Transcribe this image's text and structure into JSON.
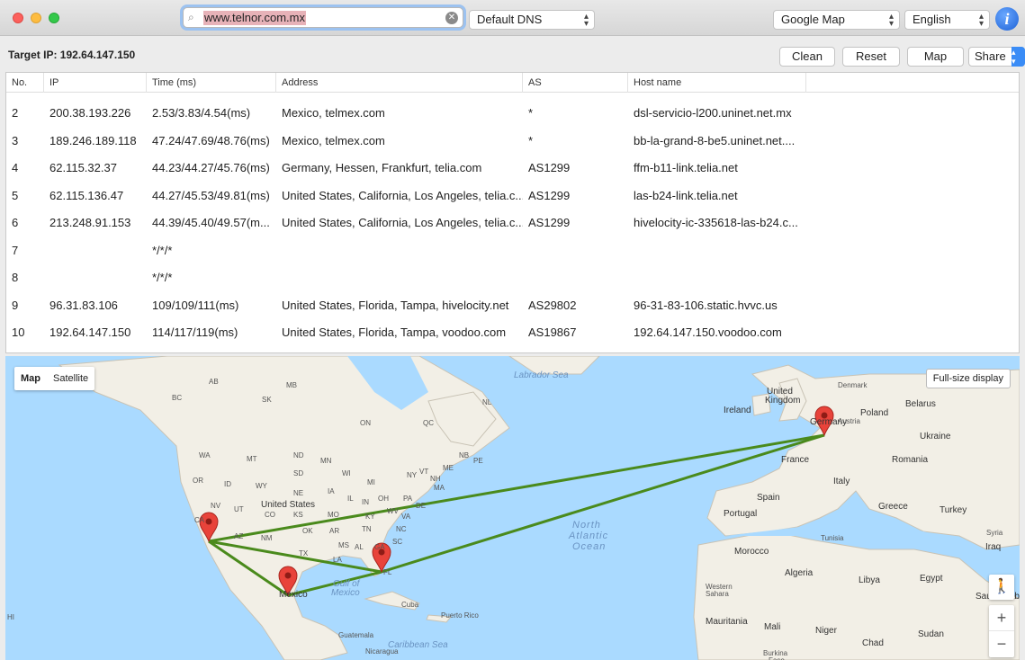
{
  "search": {
    "value": "www.telnor.com.mx"
  },
  "dns_select": {
    "value": "Default DNS"
  },
  "map_select": {
    "value": "Google Map"
  },
  "language_select": {
    "value": "English"
  },
  "target": {
    "label": "Target IP:",
    "ip": "192.64.147.150"
  },
  "buttons": {
    "clean": "Clean",
    "reset": "Reset",
    "map": "Map",
    "share": "Share"
  },
  "table": {
    "headers": [
      "No.",
      "IP",
      "Time (ms)",
      "Address",
      "AS",
      "Host name"
    ],
    "rows": [
      {
        "no": "2",
        "ip": "200.38.193.226",
        "time": "2.53/3.83/4.54(ms)",
        "address": "Mexico, telmex.com",
        "as": "*",
        "host": "dsl-servicio-l200.uninet.net.mx"
      },
      {
        "no": "3",
        "ip": "189.246.189.118",
        "time": "47.24/47.69/48.76(ms)",
        "address": "Mexico, telmex.com",
        "as": "*",
        "host": "bb-la-grand-8-be5.uninet.net...."
      },
      {
        "no": "4",
        "ip": "62.115.32.37",
        "time": "44.23/44.27/45.76(ms)",
        "address": "Germany, Hessen, Frankfurt, telia.com",
        "as": "AS1299",
        "host": "ffm-b11-link.telia.net"
      },
      {
        "no": "5",
        "ip": "62.115.136.47",
        "time": "44.27/45.53/49.81(ms)",
        "address": "United States, California, Los Angeles, telia.c...",
        "as": "AS1299",
        "host": "las-b24-link.telia.net"
      },
      {
        "no": "6",
        "ip": "213.248.91.153",
        "time": "44.39/45.40/49.57(m...",
        "address": "United States, California, Los Angeles, telia.c...",
        "as": "AS1299",
        "host": "hivelocity-ic-335618-las-b24.c..."
      },
      {
        "no": "7",
        "ip": "",
        "time": "*/*/*",
        "address": "",
        "as": "",
        "host": ""
      },
      {
        "no": "8",
        "ip": "",
        "time": "*/*/*",
        "address": "",
        "as": "",
        "host": ""
      },
      {
        "no": "9",
        "ip": "96.31.83.106",
        "time": "109/109/111(ms)",
        "address": "United States, Florida, Tampa, hivelocity.net",
        "as": "AS29802",
        "host": "96-31-83-106.static.hvvc.us"
      },
      {
        "no": "10",
        "ip": "192.64.147.150",
        "time": "114/117/119(ms)",
        "address": "United States, Florida, Tampa, voodoo.com",
        "as": "AS19867",
        "host": "192.64.147.150.voodoo.com"
      }
    ]
  },
  "map": {
    "type_map": "Map",
    "type_satellite": "Satellite",
    "fullsize": "Full-size display",
    "route_color": "#4a8a1c",
    "pin_color": "#e8433a",
    "labels": {
      "labrador_sea": "Labrador Sea",
      "north_atlantic_1": "North",
      "north_atlantic_2": "Atlantic",
      "north_atlantic_3": "Ocean",
      "gulf": "Gulf of",
      "gulf2": "Mexico",
      "caribbean": "Caribbean Sea",
      "ab": "AB",
      "mb": "MB",
      "sk": "SK",
      "bc": "BC",
      "on": "ON",
      "qc": "QC",
      "nl": "NL",
      "nb": "NB",
      "pe": "PE",
      "me": "ME",
      "nh": "NH",
      "vt": "VT",
      "ny": "NY",
      "ma": "MA",
      "wa": "WA",
      "mt": "MT",
      "nd": "ND",
      "mn": "MN",
      "or": "OR",
      "id": "ID",
      "wy": "WY",
      "sd": "SD",
      "wi": "WI",
      "mi": "MI",
      "ne": "NE",
      "ia": "IA",
      "il": "IL",
      "in": "IN",
      "oh": "OH",
      "pa": "PA",
      "nv": "NV",
      "ut": "UT",
      "co": "CO",
      "ks": "KS",
      "mo": "MO",
      "ky": "KY",
      "wv": "WV",
      "va": "VA",
      "de": "DE",
      "az": "AZ",
      "nm": "NM",
      "ok": "OK",
      "ar": "AR",
      "tn": "TN",
      "nc": "NC",
      "sc": "SC",
      "ms": "MS",
      "al": "AL",
      "ga": "GA",
      "tx": "TX",
      "la": "LA",
      "fl": "FL",
      "ca": "CA",
      "united_states": "United States",
      "mexico": "Mexico",
      "cuba": "Cuba",
      "puerto_rico": "Puerto Rico",
      "guatemala": "Guatemala",
      "nicaragua": "Nicaragua",
      "hi": "HI",
      "ireland": "Ireland",
      "united_kingdom": "United",
      "united_kingdom_2": "Kingdom",
      "denmark": "Denmark",
      "poland": "Poland",
      "belarus": "Belarus",
      "ukraine": "Ukraine",
      "germany": "Germany",
      "austria": "Austria",
      "france": "France",
      "romania": "Romania",
      "italy": "Italy",
      "spain": "Spain",
      "portugal": "Portugal",
      "greece": "Greece",
      "turkey": "Turkey",
      "syria": "Syria",
      "iraq": "Iraq",
      "tunisia": "Tunisia",
      "morocco": "Morocco",
      "algeria": "Algeria",
      "libya": "Libya",
      "egypt": "Egypt",
      "western_sahara": "Western",
      "western_sahara_2": "Sahara",
      "saudi": "Saudi Arabi",
      "mauritania": "Mauritania",
      "mali": "Mali",
      "niger": "Niger",
      "chad": "Chad",
      "sudan": "Sudan",
      "burkina": "Burkina",
      "faso": "Faso"
    }
  }
}
